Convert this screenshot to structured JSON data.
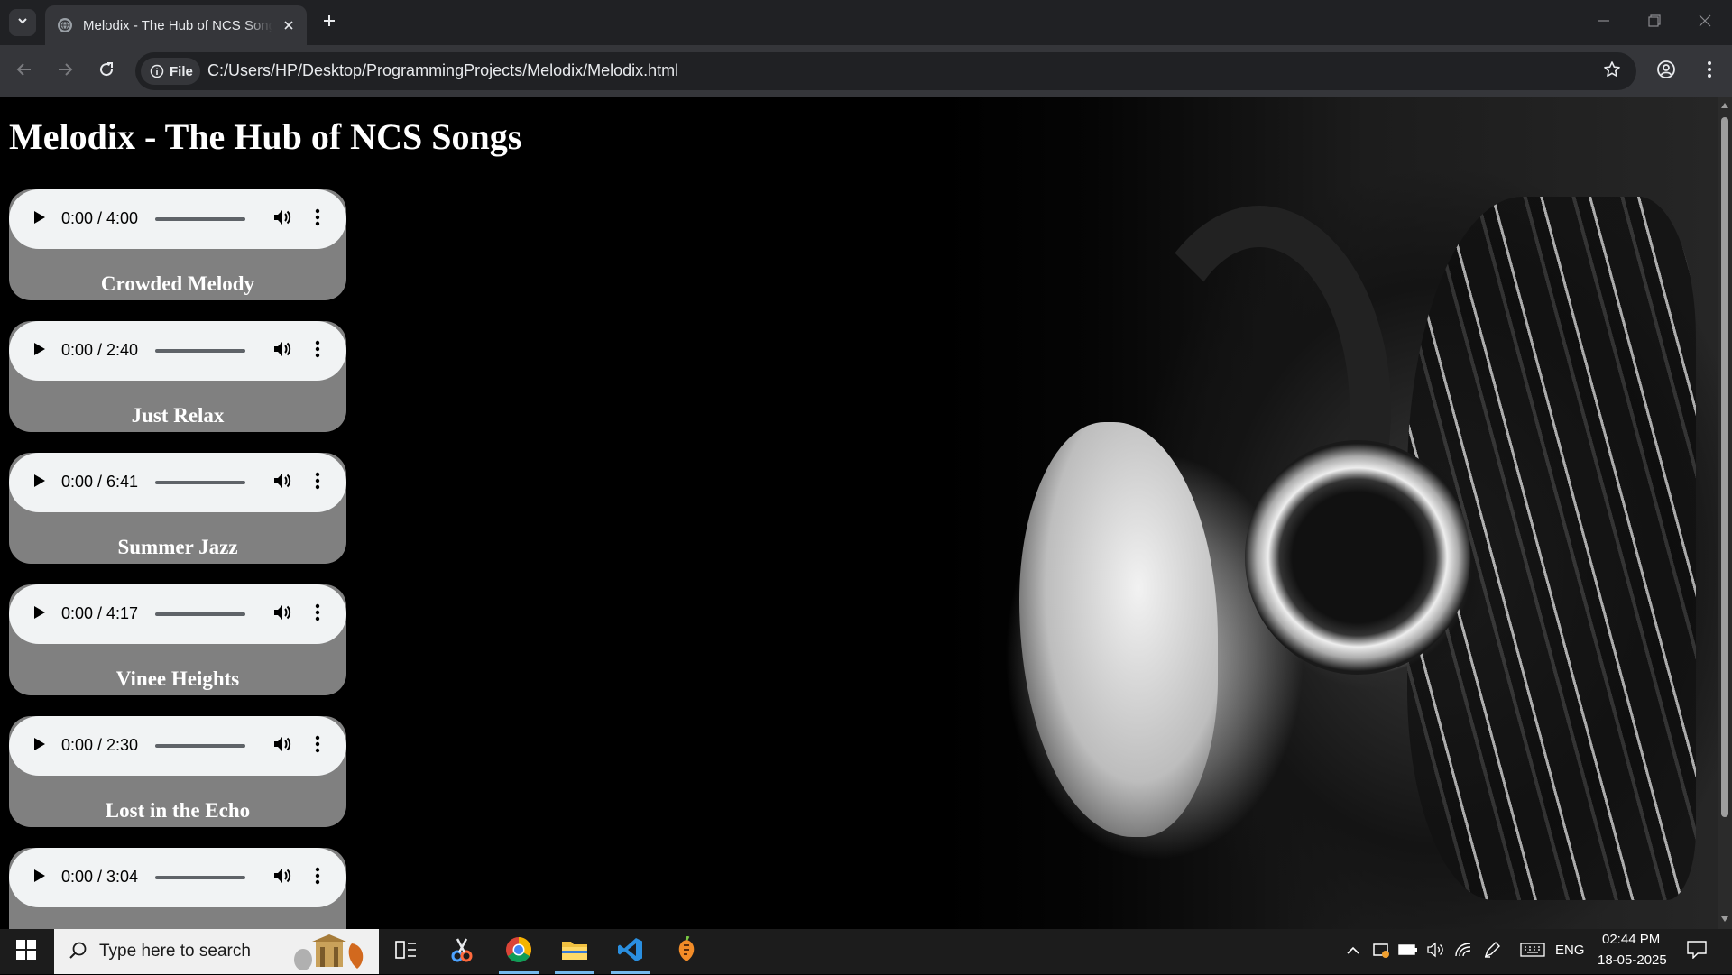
{
  "browser": {
    "tab_title": "Melodix - The Hub of NCS Songs",
    "chip_label": "File",
    "url": "C:/Users/HP/Desktop/ProgrammingProjects/Melodix/Melodix.html"
  },
  "page": {
    "title": "Melodix - The Hub of NCS Songs",
    "songs": [
      {
        "title": "Crowded Melody",
        "time": "0:00 / 4:00"
      },
      {
        "title": "Just Relax",
        "time": "0:00 / 2:40"
      },
      {
        "title": "Summer Jazz",
        "time": "0:00 / 6:41"
      },
      {
        "title": "Vinee Heights",
        "time": "0:00 / 4:17"
      },
      {
        "title": "Lost in the Echo",
        "time": "0:00 / 2:30"
      },
      {
        "title": "",
        "time": "0:00 / 3:04"
      }
    ]
  },
  "taskbar": {
    "search_placeholder": "Type here to search",
    "language": "ENG",
    "time": "02:44 PM",
    "date": "18-05-2025"
  },
  "icons": {
    "tab_search": "chevron-down-icon",
    "favicon": "globe-icon",
    "tab_close": "close-icon",
    "new_tab": "plus-icon",
    "back": "arrow-left-icon",
    "forward": "arrow-right-icon",
    "reload": "reload-icon",
    "site_info": "info-icon",
    "bookmark": "star-icon",
    "profile": "profile-icon",
    "menu": "kebab-menu-icon",
    "play": "play-icon",
    "volume": "volume-icon",
    "audio_more": "more-vertical-icon"
  },
  "colors": {
    "card": "#808080",
    "audio_control": "#f1f3f4",
    "page_background": "#000000",
    "accent": "#76b9ed"
  }
}
